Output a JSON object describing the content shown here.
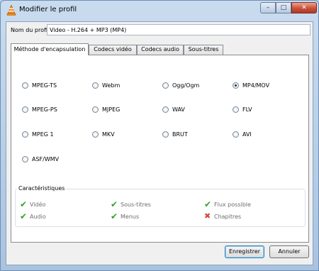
{
  "window": {
    "title": "Modifier le profil",
    "minimize_glyph": "–",
    "maximize_glyph": "□",
    "close_glyph": "✕"
  },
  "profile": {
    "label": "Nom du profil",
    "value": "Video - H.264 + MP3 (MP4)"
  },
  "tabs": [
    {
      "label": "Méthode d'encapsulation",
      "active": true
    },
    {
      "label": "Codecs vidéo",
      "active": false
    },
    {
      "label": "Codecs audio",
      "active": false
    },
    {
      "label": "Sous-titres",
      "active": false
    }
  ],
  "encapsulation": {
    "options": [
      {
        "label": "MPEG-TS",
        "checked": false
      },
      {
        "label": "Webm",
        "checked": false
      },
      {
        "label": "Ogg/Ogm",
        "checked": false
      },
      {
        "label": "MP4/MOV",
        "checked": true
      },
      {
        "label": "MPEG-PS",
        "checked": false
      },
      {
        "label": "MJPEG",
        "checked": false
      },
      {
        "label": "WAV",
        "checked": false
      },
      {
        "label": "FLV",
        "checked": false
      },
      {
        "label": "MPEG 1",
        "checked": false
      },
      {
        "label": "MKV",
        "checked": false
      },
      {
        "label": "BRUT",
        "checked": false
      },
      {
        "label": "AVI",
        "checked": false
      },
      {
        "label": "ASF/WMV",
        "checked": false
      }
    ]
  },
  "features": {
    "title": "Caractéristiques",
    "items": [
      {
        "label": "Vidéo",
        "supported": true
      },
      {
        "label": "Sous-titres",
        "supported": true
      },
      {
        "label": "Flux possible",
        "supported": true
      },
      {
        "label": "Audio",
        "supported": true
      },
      {
        "label": "Menus",
        "supported": true
      },
      {
        "label": "Chapitres",
        "supported": false
      }
    ],
    "check_glyph": "✔",
    "cross_glyph": "✖"
  },
  "buttons": {
    "save": "Enregistrer",
    "cancel": "Annuler"
  },
  "colors": {
    "check": "#2ea22e",
    "cross": "#d9473b"
  }
}
